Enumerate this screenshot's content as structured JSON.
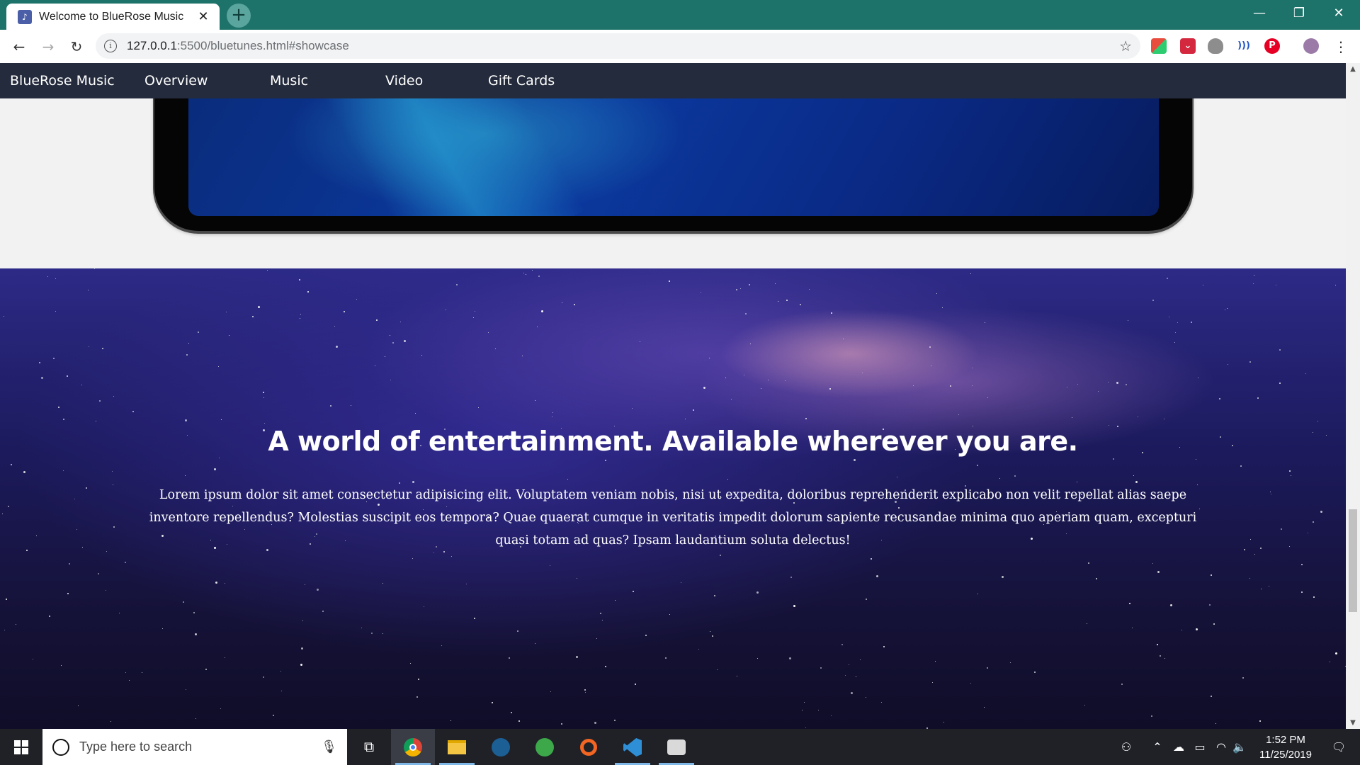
{
  "browser": {
    "tab_title": "Welcome to BlueRose Music",
    "tab_favicon": "music-note-icon",
    "url_host": "127.0.0.1",
    "url_rest": ":5500/bluetunes.html#showcase",
    "extensions": [
      "office-icon",
      "pocket-icon",
      "shield-icon",
      "reader-icon",
      "pinterest-icon",
      "profile-avatar"
    ]
  },
  "site": {
    "brand": "BlueRose Music",
    "nav": [
      "Overview",
      "Music",
      "Video",
      "Gift Cards"
    ],
    "nav_color": "#242b3c",
    "showcase": {
      "title": "A world of entertainment. Available wherever you are.",
      "text": "Lorem ipsum dolor sit amet consectetur adipisicing elit. Voluptatem veniam nobis, nisi ut expedita, doloribus reprehenderit explicabo non velit repellat alias saepe inventore repellendus? Molestias suscipit eos tempora? Quae quaerat cumque in veritatis impedit dolorum sapiente recusandae minima quo aperiam quam, excepturi quasi totam ad quas? Ipsam laudantium soluta delectus!"
    }
  },
  "taskbar": {
    "search_placeholder": "Type here to search",
    "apps": [
      "chrome-icon",
      "file-explorer-icon",
      "steam-icon",
      "app-icon",
      "origin-icon",
      "vscode-icon",
      "app-icon-2"
    ],
    "time": "1:52 PM",
    "date": "11/25/2019"
  }
}
